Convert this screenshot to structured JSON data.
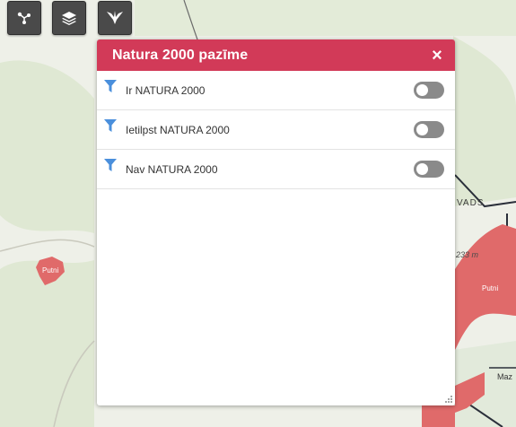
{
  "map": {
    "labels": {
      "putni_left": "Putni",
      "putni_right": "Putni",
      "vads": "VADS",
      "elevation": "233 m",
      "maz": "Maz"
    },
    "colors": {
      "protected_area": "#e06a6a",
      "forest": "#dfe8d3",
      "boundary": "#2a2f3a"
    }
  },
  "toolbar": {
    "buttons": [
      {
        "icon": "nodes-icon"
      },
      {
        "icon": "layers-icon"
      },
      {
        "icon": "bird-icon"
      }
    ]
  },
  "panel": {
    "title": "Natura 2000 pazīme",
    "close_symbol": "×",
    "accent": "#d23a58",
    "filters": [
      {
        "label": "Ir NATURA 2000",
        "enabled": false
      },
      {
        "label": "Ietilpst NATURA 2000",
        "enabled": false
      },
      {
        "label": "Nav NATURA 2000",
        "enabled": false
      }
    ]
  }
}
